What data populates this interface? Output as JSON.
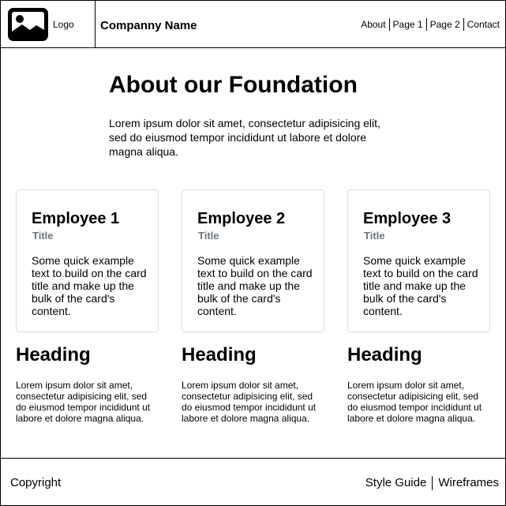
{
  "header": {
    "logo_label": "Logo",
    "company_name": "Companny Name",
    "nav": [
      "About",
      "Page 1",
      "Page 2",
      "Contact"
    ]
  },
  "intro": {
    "title": "About our Foundation",
    "text": "Lorem ipsum dolor sit amet, consectetur adipisicing elit, sed do eiusmod tempor incididunt ut labore et dolore magna aliqua."
  },
  "cards": [
    {
      "title": "Employee 1",
      "subtitle": "Title",
      "text": "Some quick example text to build on the card title and make up the bulk of the card's content."
    },
    {
      "title": "Employee 2",
      "subtitle": "Title",
      "text": "Some quick example text to build on the card title and make up the bulk of the card's content."
    },
    {
      "title": "Employee 3",
      "subtitle": "Title",
      "text": "Some quick example text to build on the card title and make up the bulk of the card's content."
    }
  ],
  "columns": [
    {
      "heading": "Heading",
      "text": "Lorem ipsum dolor sit amet, consectetur adipisicing elit, sed do eiusmod tempor incididunt ut labore et dolore magna aliqua."
    },
    {
      "heading": "Heading",
      "text": "Lorem ipsum dolor sit amet, consectetur adipisicing elit, sed do eiusmod tempor incididunt ut labore et dolore magna aliqua."
    },
    {
      "heading": "Heading",
      "text": "Lorem ipsum dolor sit amet, consectetur adipisicing elit, sed do eiusmod tempor incididunt ut labore et dolore magna aliqua."
    }
  ],
  "footer": {
    "copyright": "Copyright",
    "links": [
      "Style Guide",
      "Wireframes"
    ]
  },
  "colors": {
    "border": "#000000",
    "card_border": "#dcdcdc",
    "subtitle": "#6c757d"
  },
  "icons": {
    "logo": "image-icon"
  }
}
